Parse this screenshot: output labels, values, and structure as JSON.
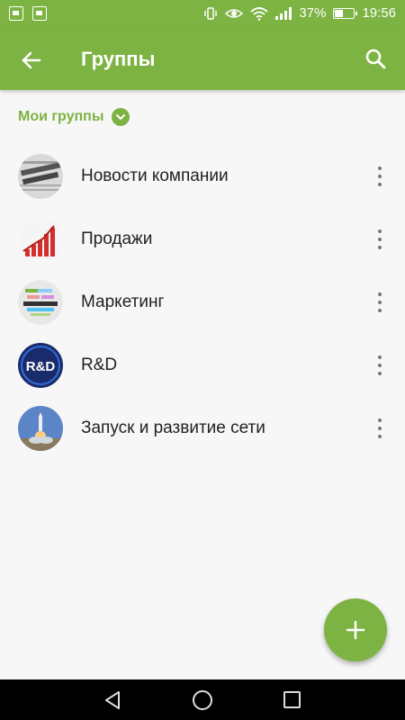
{
  "status_bar": {
    "battery": "37%",
    "battery_level": 0.37,
    "time": "19:56",
    "icons": [
      "notification-icon",
      "image-icon",
      "vibrate-icon",
      "eye-icon",
      "wifi-icon",
      "signal-icon",
      "battery-icon"
    ]
  },
  "app_bar": {
    "title": "Группы",
    "back_icon": "arrow-left-icon",
    "search_icon": "search-icon"
  },
  "section": {
    "label": "Мои группы",
    "icon": "chevron-down-icon"
  },
  "groups": [
    {
      "label": "Новости компании",
      "avatar": "latest-news-image"
    },
    {
      "label": "Продажи",
      "avatar": "sales-chart-image"
    },
    {
      "label": "Маркетинг",
      "avatar": "marketing-words-image"
    },
    {
      "label": "R&D",
      "avatar": "rd-logo-image",
      "avatar_text": "R&D"
    },
    {
      "label": "Запуск и развитие сети",
      "avatar": "rocket-launch-image"
    }
  ],
  "fab": {
    "icon": "plus-icon"
  },
  "colors": {
    "accent": "#7cb342",
    "background": "#f7f7f7",
    "text": "#222222"
  }
}
